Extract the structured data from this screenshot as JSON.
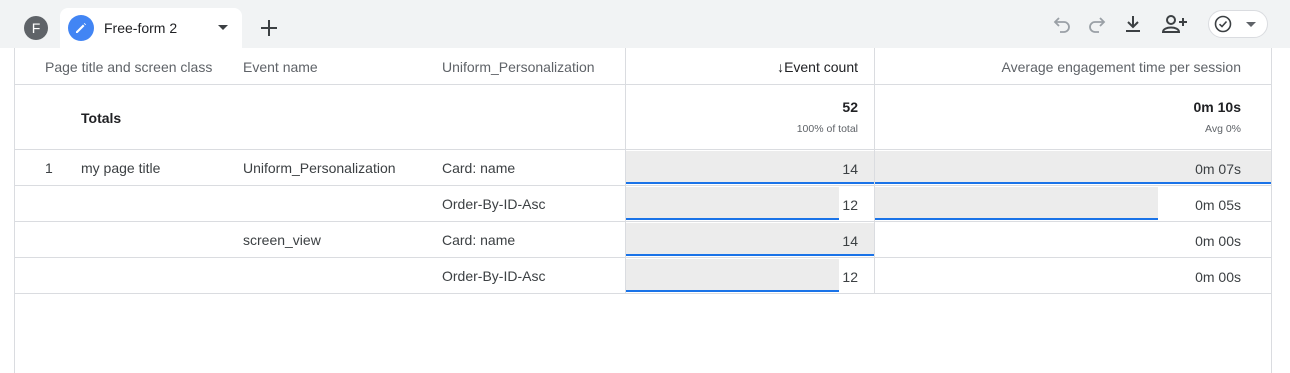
{
  "header": {
    "avatar_letter": "F",
    "tab_title": "Free-form 2"
  },
  "icons": {
    "undo": "undo-icon",
    "redo": "redo-icon",
    "download": "download-icon",
    "share": "person-add-icon",
    "check": "check-circle-icon"
  },
  "colors": {
    "accent": "#1a73e8",
    "tab_icon": "#4285f4",
    "bar_fill": "#ececec"
  },
  "table": {
    "columns": [
      "Page title and screen class",
      "Event name",
      "Uniform_Personalization",
      "↓Event count",
      "Average engagement time per session"
    ],
    "totals": {
      "label": "Totals",
      "event_count": "52",
      "event_count_sub": "100% of total",
      "engagement": "0m 10s",
      "engagement_sub": "Avg 0%"
    },
    "rows": [
      {
        "index": "1",
        "page_title": "my page title",
        "event_name": "Uniform_Personalization",
        "personalization": "Card: name",
        "event_count": "14",
        "engagement": "0m 07s",
        "count_fraction": 1.0,
        "engagement_fraction": 1.0
      },
      {
        "index": "",
        "page_title": "",
        "event_name": "",
        "personalization": "Order-By-ID-Asc",
        "event_count": "12",
        "engagement": "0m 05s",
        "count_fraction": 0.857,
        "engagement_fraction": 0.714
      },
      {
        "index": "",
        "page_title": "",
        "event_name": "screen_view",
        "personalization": "Card: name",
        "event_count": "14",
        "engagement": "0m 00s",
        "count_fraction": 1.0,
        "engagement_fraction": 0
      },
      {
        "index": "",
        "page_title": "",
        "event_name": "",
        "personalization": "Order-By-ID-Asc",
        "event_count": "12",
        "engagement": "0m 00s",
        "count_fraction": 0.857,
        "engagement_fraction": 0
      }
    ]
  }
}
